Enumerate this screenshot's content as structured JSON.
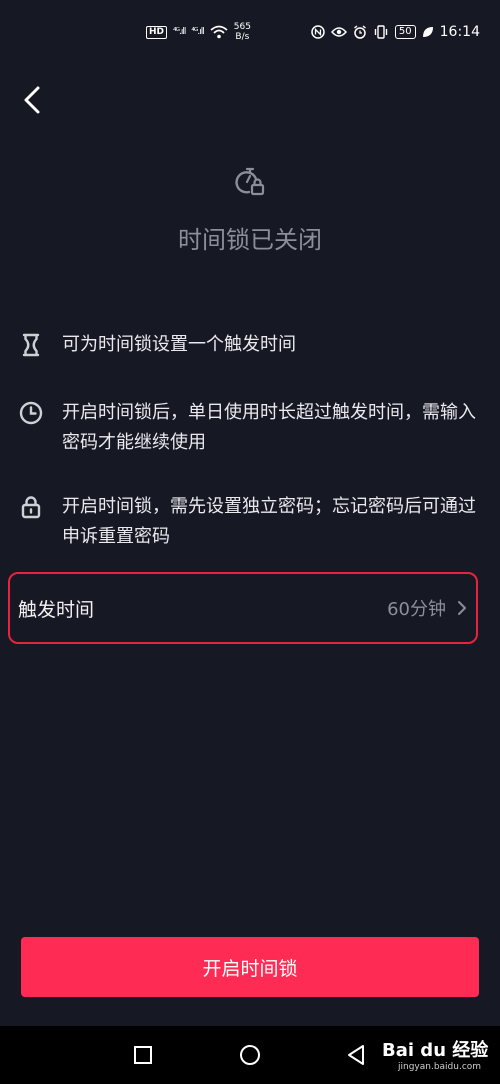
{
  "status_bar": {
    "hd": "HD",
    "signal_1": "⁴ᴳ.ıll",
    "signal_2": "⁴ᴳ.ıll",
    "net_speed_value": "565",
    "net_speed_unit": "B/s",
    "battery": "50",
    "time": "16:14"
  },
  "hero": {
    "title": "时间锁已关闭"
  },
  "features": [
    {
      "text": "可为时间锁设置一个触发时间"
    },
    {
      "text": "开启时间锁后，单日使用时长超过触发时间，需输入密码才能继续使用"
    },
    {
      "text": "开启时间锁，需先设置独立密码；忘记密码后可通过申诉重置密码"
    }
  ],
  "trigger": {
    "label": "触发时间",
    "value": "60分钟"
  },
  "primary_button": {
    "label": "开启时间锁"
  },
  "watermark": {
    "text": "Bai du 经验",
    "sub": "jingyan.baidu.com"
  },
  "colors": {
    "background": "#161823",
    "accent": "#fe2c55",
    "highlight_border": "#e8233f"
  }
}
